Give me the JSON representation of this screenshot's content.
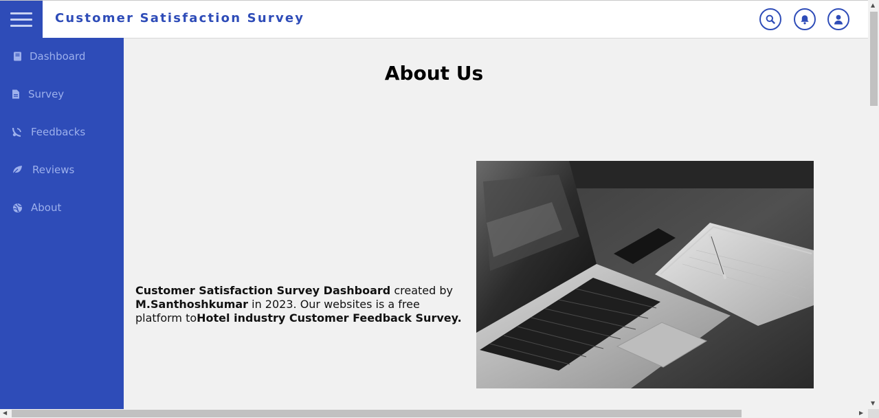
{
  "header": {
    "title": "Customer Satisfaction Survey",
    "menu_icon": "hamburger-icon",
    "actions": [
      {
        "name": "search-button",
        "icon": "search-icon"
      },
      {
        "name": "notifications-button",
        "icon": "bell-icon"
      },
      {
        "name": "profile-button",
        "icon": "user-icon"
      }
    ]
  },
  "sidebar": {
    "items": [
      {
        "label": "Dashboard",
        "icon": "book-icon"
      },
      {
        "label": "Survey",
        "icon": "document-icon"
      },
      {
        "label": "Feedbacks",
        "icon": "chat-icon"
      },
      {
        "label": "Reviews",
        "icon": "leaf-icon"
      },
      {
        "label": "About",
        "icon": "globe-icon"
      }
    ]
  },
  "main": {
    "heading": "About Us",
    "about": {
      "strong1": "Customer Satisfaction Survey Dashboard",
      "text1": " created by ",
      "strong2": "M.Santhoshkumar",
      "text2": " in 2023. Our websites is a free platform to",
      "strong3": "Hotel industry Customer Feedback Survey."
    },
    "image_icon": "laptop-photo"
  },
  "colors": {
    "primary": "#2e4cb8",
    "sidebar_text": "#9db0ec",
    "content_bg": "#f1f1f1"
  }
}
